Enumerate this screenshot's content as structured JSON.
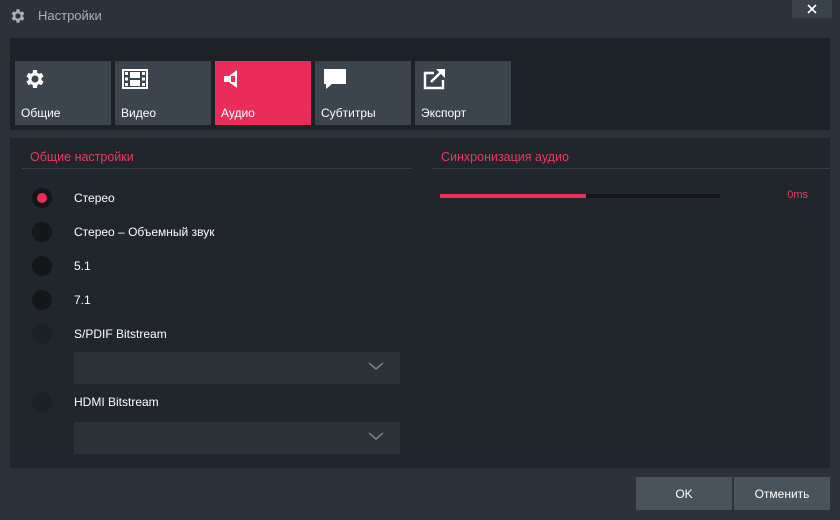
{
  "window": {
    "title": "Настройки",
    "title_icon": "gear-icon",
    "close_icon": "close-icon"
  },
  "tabs": [
    {
      "label": "Общие",
      "icon": "gear-icon"
    },
    {
      "label": "Видео",
      "icon": "film-icon"
    },
    {
      "label": "Аудио",
      "icon": "speaker-icon",
      "active": true
    },
    {
      "label": "Субтитры",
      "icon": "speech-bubble-icon"
    },
    {
      "label": "Экспорт",
      "icon": "export-icon"
    }
  ],
  "general": {
    "title": "Общие настройки",
    "options": [
      {
        "label": "Стерео",
        "checked": true
      },
      {
        "label": "Стерео – Объемный звук"
      },
      {
        "label": "5.1"
      },
      {
        "label": "7.1"
      },
      {
        "label": "S/PDIF Bitstream",
        "disabled": true
      },
      {
        "label": "HDMI Bitstream",
        "disabled": true
      }
    ],
    "spdif_dropdown_value": "",
    "hdmi_dropdown_value": ""
  },
  "sync": {
    "title": "Синхронизация аудио",
    "value": "0ms",
    "slider_fraction": 0.52
  },
  "buttons": {
    "ok": "OK",
    "cancel": "Отменить"
  },
  "colors": {
    "accent": "#ea2c5b",
    "background": "#2b323a",
    "panel": "#20262b",
    "tab": "#3c454d"
  }
}
